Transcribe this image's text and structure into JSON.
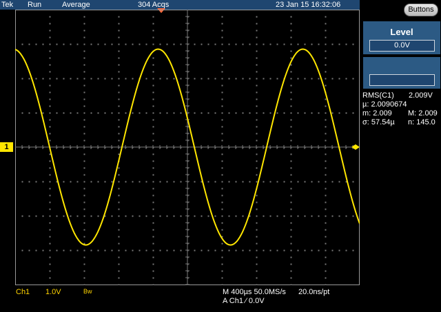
{
  "status_bar": {
    "brand": "Tek",
    "run_state": "Run",
    "acq_mode": "Average",
    "acq_count": "304 Acqs",
    "datetime": "23 Jan 15 16:32:06"
  },
  "buttons_label": "Buttons",
  "level_panel": {
    "title": "Level",
    "value": "0.0V"
  },
  "blank_panel": {
    "value": ""
  },
  "measurements": {
    "rms_label": "RMS(C1)",
    "rms_value": "2.009V",
    "mu_line": "µ: 2.0090674",
    "m_line": "m: 2.009",
    "M_line": "M: 2.009",
    "sigma_line": "σ: 57.54µ",
    "n_line": "n:  145.0"
  },
  "channel_marker": "1",
  "bottom_bar": {
    "ch": "Ch1",
    "volts_div": "1.0V",
    "bw": "Bw",
    "timebase": "M 400µs 50.0MS/s",
    "pt_rate": "20.0ns/pt",
    "trigger": "A  Ch1  ⁄  0.0V"
  },
  "waveform": {
    "color": "#ffe600",
    "shape": "sine",
    "amplitude_divs": 2.85,
    "period_divs": 4.2,
    "phase_divs": 1.0
  },
  "colors": {
    "status_bg": "#1f4670",
    "panel_bg": "#2c5a84",
    "trace": "#ffe600",
    "trigger_marker": "#ff6a3c"
  }
}
